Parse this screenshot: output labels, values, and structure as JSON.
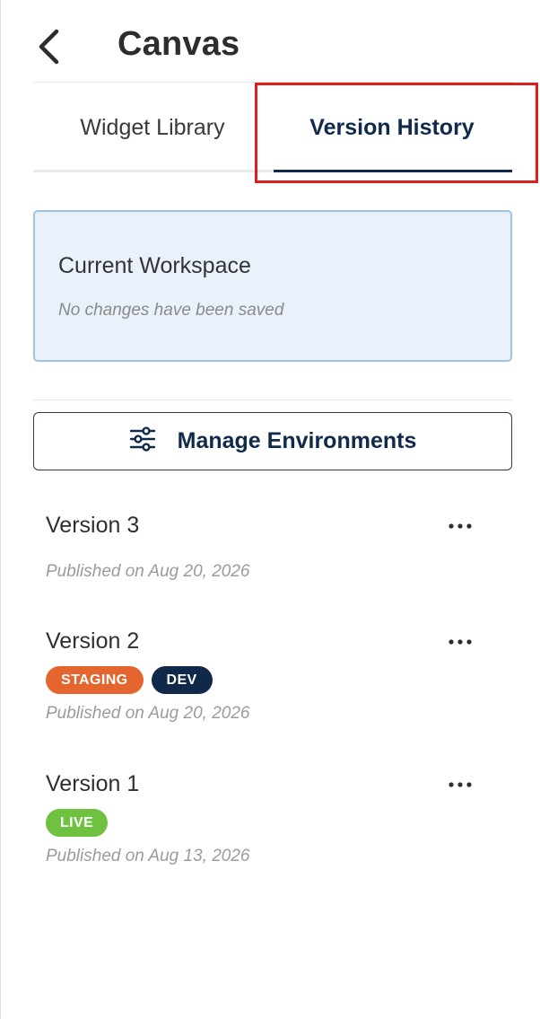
{
  "header": {
    "title": "Canvas",
    "back_icon": "chevron-left-icon"
  },
  "tabs": [
    {
      "label": "Widget Library",
      "active": false
    },
    {
      "label": "Version History",
      "active": true
    }
  ],
  "colors": {
    "accent": "#0f2a4a",
    "highlight": "#e01e1e",
    "workspace_bg": "#e9f1fb",
    "staging": "#e4662e",
    "dev": "#10284a",
    "live": "#6ec23f"
  },
  "workspace": {
    "title": "Current Workspace",
    "subtitle": "No changes have been saved"
  },
  "manage_button": {
    "label": "Manage Environments",
    "icon": "sliders-icon"
  },
  "versions": [
    {
      "name": "Version 3",
      "published": "Published on Aug 20, 2026",
      "badges": []
    },
    {
      "name": "Version 2",
      "published": "Published on Aug 20, 2026",
      "badges": [
        "STAGING",
        "DEV"
      ]
    },
    {
      "name": "Version 1",
      "published": "Published on Aug 13, 2026",
      "badges": [
        "LIVE"
      ]
    }
  ]
}
